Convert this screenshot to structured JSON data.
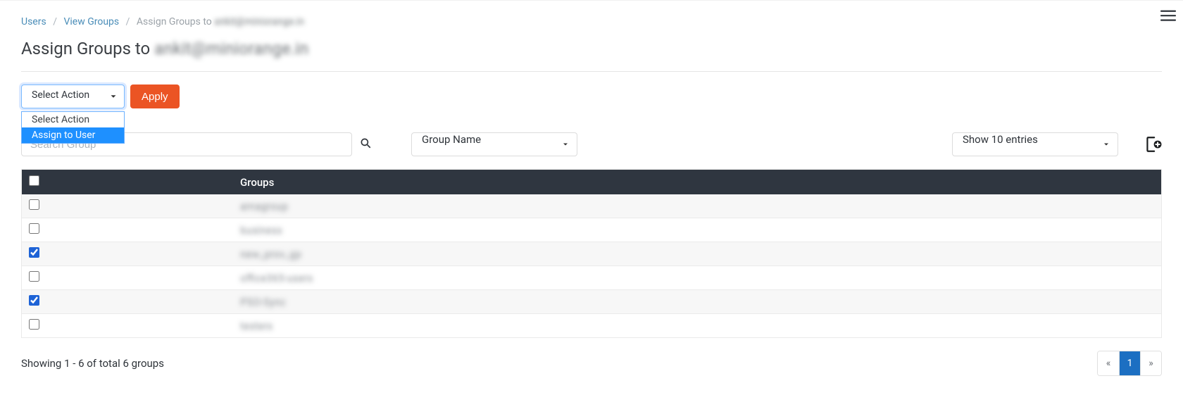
{
  "breadcrumb": {
    "users": "Users",
    "view_groups": "View Groups",
    "current_prefix": "Assign Groups to",
    "current_user": "ankit@miniorange.in"
  },
  "page_title_prefix": "Assign Groups to",
  "page_title_user": "ankit@miniorange.in",
  "action_select": {
    "placeholder": "Select Action",
    "options": [
      "Select Action",
      "Assign to User"
    ],
    "highlighted_index": 1
  },
  "apply_label": "Apply",
  "search": {
    "placeholder": "Search Group"
  },
  "group_filter": {
    "selected": "Group Name"
  },
  "entries_filter": {
    "selected": "Show 10 entries"
  },
  "table": {
    "header_groups": "Groups",
    "rows": [
      {
        "checked": false,
        "name": "amagroup"
      },
      {
        "checked": false,
        "name": "business"
      },
      {
        "checked": true,
        "name": "new_prov_gp"
      },
      {
        "checked": false,
        "name": "office365-users"
      },
      {
        "checked": true,
        "name": "PSO-Sync"
      },
      {
        "checked": false,
        "name": "testers"
      }
    ]
  },
  "showing_text": "Showing 1 - 6 of total 6 groups",
  "pager": {
    "prev": "«",
    "page": "1",
    "next": "»"
  }
}
